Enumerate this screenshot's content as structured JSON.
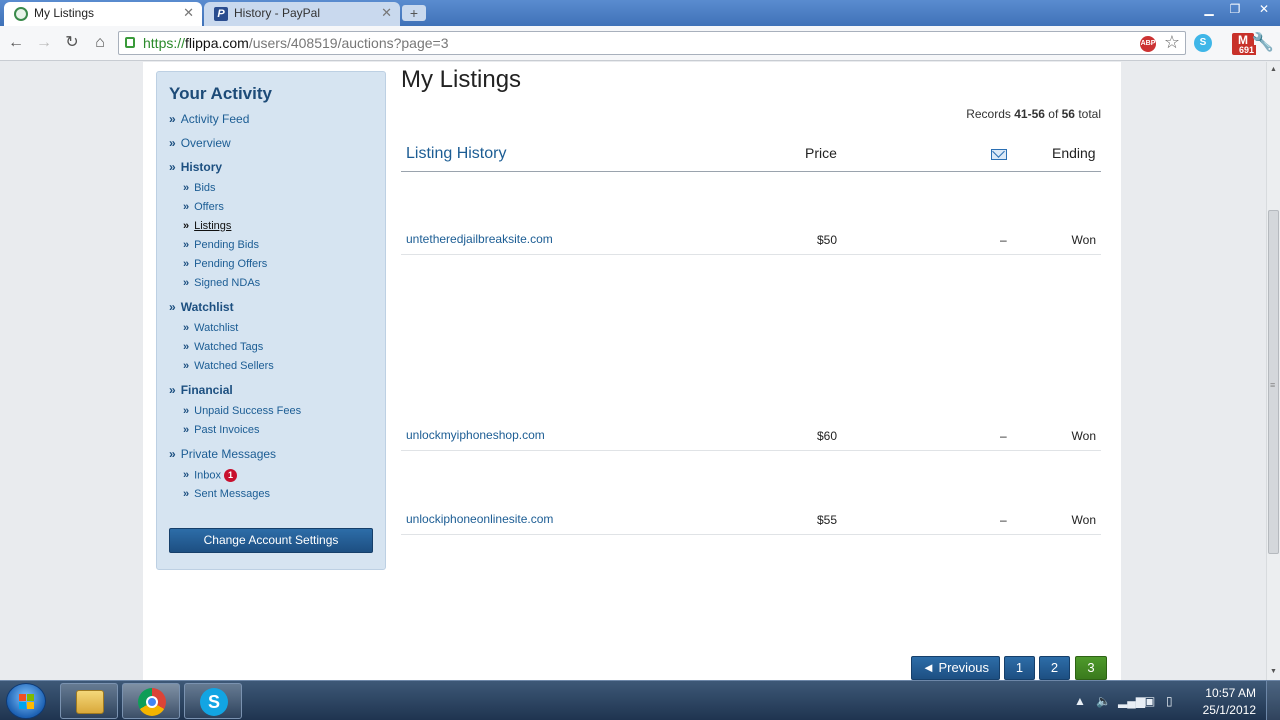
{
  "browser": {
    "tabs": [
      {
        "title": "My Listings",
        "active": true
      },
      {
        "title": "History - PayPal",
        "active": false
      }
    ],
    "url": {
      "scheme": "https://",
      "host": "flippa.com",
      "path": "/users/408519/auctions?page=3"
    },
    "gmail_count": "691",
    "abp_label": "ABP"
  },
  "sidebar": {
    "title": "Your Activity",
    "items": [
      {
        "label": "Activity Feed",
        "level": 1
      },
      {
        "label": "Overview",
        "level": 1
      },
      {
        "label": "History",
        "level": 1,
        "section": true
      },
      {
        "label": "Bids",
        "level": 2
      },
      {
        "label": "Offers",
        "level": 2
      },
      {
        "label": "Listings",
        "level": 2,
        "current": true
      },
      {
        "label": "Pending Bids",
        "level": 2
      },
      {
        "label": "Pending Offers",
        "level": 2
      },
      {
        "label": "Signed NDAs",
        "level": 2
      },
      {
        "label": "Watchlist",
        "level": 1,
        "section": true
      },
      {
        "label": "Watchlist",
        "level": 2
      },
      {
        "label": "Watched Tags",
        "level": 2
      },
      {
        "label": "Watched Sellers",
        "level": 2
      },
      {
        "label": "Financial",
        "level": 1,
        "section": true
      },
      {
        "label": "Unpaid Success Fees",
        "level": 2
      },
      {
        "label": "Past Invoices",
        "level": 2
      },
      {
        "label": "Private Messages",
        "level": 1
      },
      {
        "label": "Inbox",
        "level": 2,
        "badge": "1"
      },
      {
        "label": "Sent Messages",
        "level": 2
      }
    ],
    "settings_button": "Change Account Settings"
  },
  "main": {
    "title": "My Listings",
    "records": {
      "prefix": "Records ",
      "range": "41-56",
      "mid": " of ",
      "total": "56",
      "suffix": " total"
    },
    "headers": {
      "listing": "Listing History",
      "price": "Price",
      "message_icon": "envelope-icon",
      "ending": "Ending"
    },
    "rows": [
      {
        "name": "untetheredjailbreaksite.com",
        "price": "$50",
        "message": "–",
        "status": "Won"
      },
      {
        "name": "unlockmyiphoneshop.com",
        "price": "$60",
        "message": "–",
        "status": "Won"
      },
      {
        "name": "unlockiphoneonlinesite.com",
        "price": "$55",
        "message": "–",
        "status": "Won"
      }
    ],
    "pagination": {
      "previous": "◄  Previous",
      "pages": [
        "1",
        "2",
        "3"
      ],
      "current": "3"
    }
  },
  "taskbar": {
    "time": "10:57 AM",
    "date": "25/1/2012"
  }
}
